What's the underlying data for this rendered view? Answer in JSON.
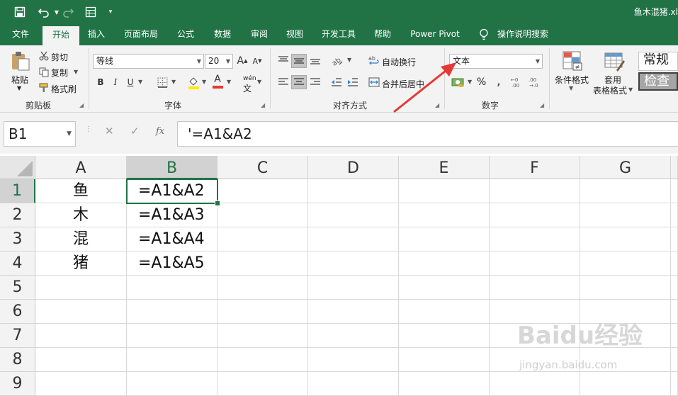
{
  "window": {
    "document_title": "鱼木混猪.xl"
  },
  "ribbon_tabs": [
    {
      "label": "文件"
    },
    {
      "label": "开始"
    },
    {
      "label": "插入"
    },
    {
      "label": "页面布局"
    },
    {
      "label": "公式"
    },
    {
      "label": "数据"
    },
    {
      "label": "审阅"
    },
    {
      "label": "视图"
    },
    {
      "label": "开发工具"
    },
    {
      "label": "帮助"
    },
    {
      "label": "Power Pivot"
    },
    {
      "label": "操作说明搜索"
    }
  ],
  "active_tab": "开始",
  "clipboard": {
    "paste": "粘贴",
    "cut": "剪切",
    "copy": "复制",
    "format_painter": "格式刷",
    "group": "剪贴板"
  },
  "font": {
    "name": "等线",
    "size": "20",
    "grow": "A",
    "shrink": "A",
    "bold": "B",
    "italic": "I",
    "underline": "U",
    "font_color": "A",
    "phonetic": "wén",
    "group": "字体"
  },
  "alignment": {
    "wrap_text": "自动换行",
    "merge_center": "合并后居中",
    "group": "对齐方式"
  },
  "number": {
    "format": "文本",
    "percent": "%",
    "group": "数字"
  },
  "styles": {
    "conditional": "条件格式",
    "table_format_1": "套用",
    "table_format_2": "表格格式",
    "style_normal": "常规",
    "style_check": "检查"
  },
  "formula_bar": {
    "name_box": "B1",
    "fx": "fx",
    "cancel": "✕",
    "enter": "✓",
    "content": "'=A1&A2"
  },
  "columns": [
    "A",
    "B",
    "C",
    "D",
    "E",
    "F",
    "G"
  ],
  "rows": [
    "1",
    "2",
    "3",
    "4",
    "5",
    "6",
    "7",
    "8",
    "9"
  ],
  "cells": {
    "A": [
      "鱼",
      "木",
      "混",
      "猪",
      "",
      "",
      "",
      "",
      ""
    ],
    "B": [
      "=A1&A2",
      "=A1&A3",
      "=A1&A4",
      "=A1&A5",
      "",
      "",
      "",
      "",
      ""
    ]
  },
  "selected_cell": "B1",
  "colors": {
    "excel_green": "#217346",
    "annotation_arrow": "#e53935"
  },
  "watermark": {
    "brand": "Baidu经验",
    "url": "jingyan.baidu.com"
  }
}
